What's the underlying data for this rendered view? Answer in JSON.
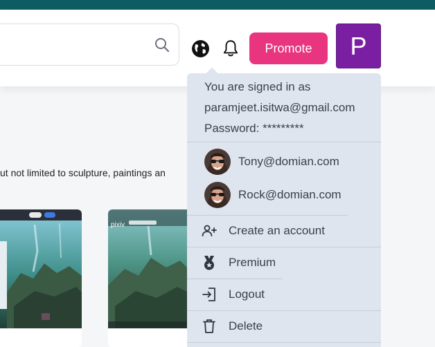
{
  "header": {
    "search": {
      "placeholder": ""
    },
    "promote_label": "Promote",
    "avatar_letter": "P"
  },
  "page": {
    "body_text": "ut not limited to sculpture, paintings an"
  },
  "cards": [
    {
      "toolbar_button_1": "",
      "toolbar_button_2": ""
    },
    {
      "brand": "pixiv"
    }
  ],
  "menu": {
    "signed_in_as": "You are signed in as",
    "email": "paramjeet.isitwa@gmail.com",
    "password_line": "Password: *********",
    "accounts": [
      {
        "email": "Tony@domian.com"
      },
      {
        "email": "Rock@domian.com"
      }
    ],
    "items": [
      {
        "label": "Create an account",
        "icon": "add-user-icon"
      },
      {
        "label": "Premium",
        "icon": "medal-icon"
      },
      {
        "label": "Logout",
        "icon": "logout-icon"
      },
      {
        "label": "Delete",
        "icon": "trash-icon"
      }
    ]
  },
  "colors": {
    "topbar": "#0d5c63",
    "promote": "#e9347f",
    "avatar": "#7b1fa2",
    "menu_bg": "#dfe5ef"
  }
}
